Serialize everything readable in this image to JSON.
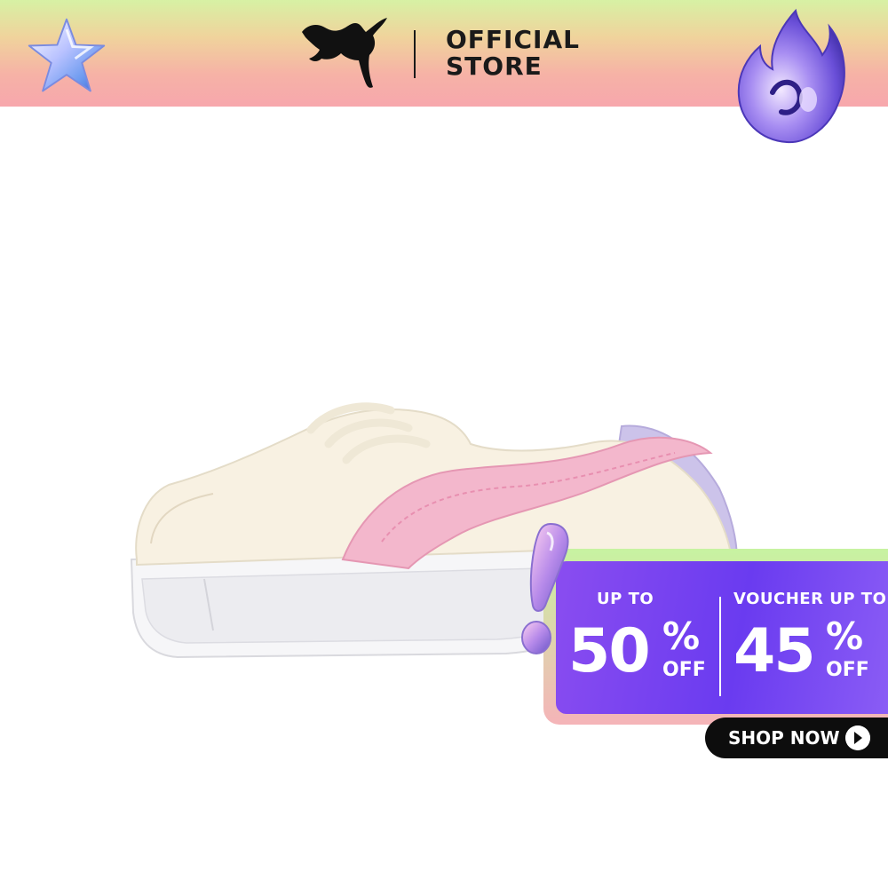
{
  "header": {
    "brand_icon": "puma-cat-logo",
    "store_line1": "OFFICIAL",
    "store_line2": "STORE",
    "decor_left": "chrome-star-icon",
    "decor_right": "chrome-flame-icon"
  },
  "product": {
    "image": "pastel-platform-sneaker"
  },
  "promo": {
    "left_label": "UP TO",
    "left_value": "50",
    "left_percent": "%",
    "left_suffix": "OFF",
    "right_label": "VOUCHER UP TO",
    "right_value": "45",
    "right_percent": "%",
    "right_suffix": "OFF",
    "cta_label": "SHOP NOW",
    "cta_icon": "arrow-right-icon"
  },
  "colors": {
    "header_top": "#d7f1a4",
    "header_bottom": "#f7a7ad",
    "promo_purple": "#6a3bf0",
    "cta_black": "#0d0d0d"
  }
}
